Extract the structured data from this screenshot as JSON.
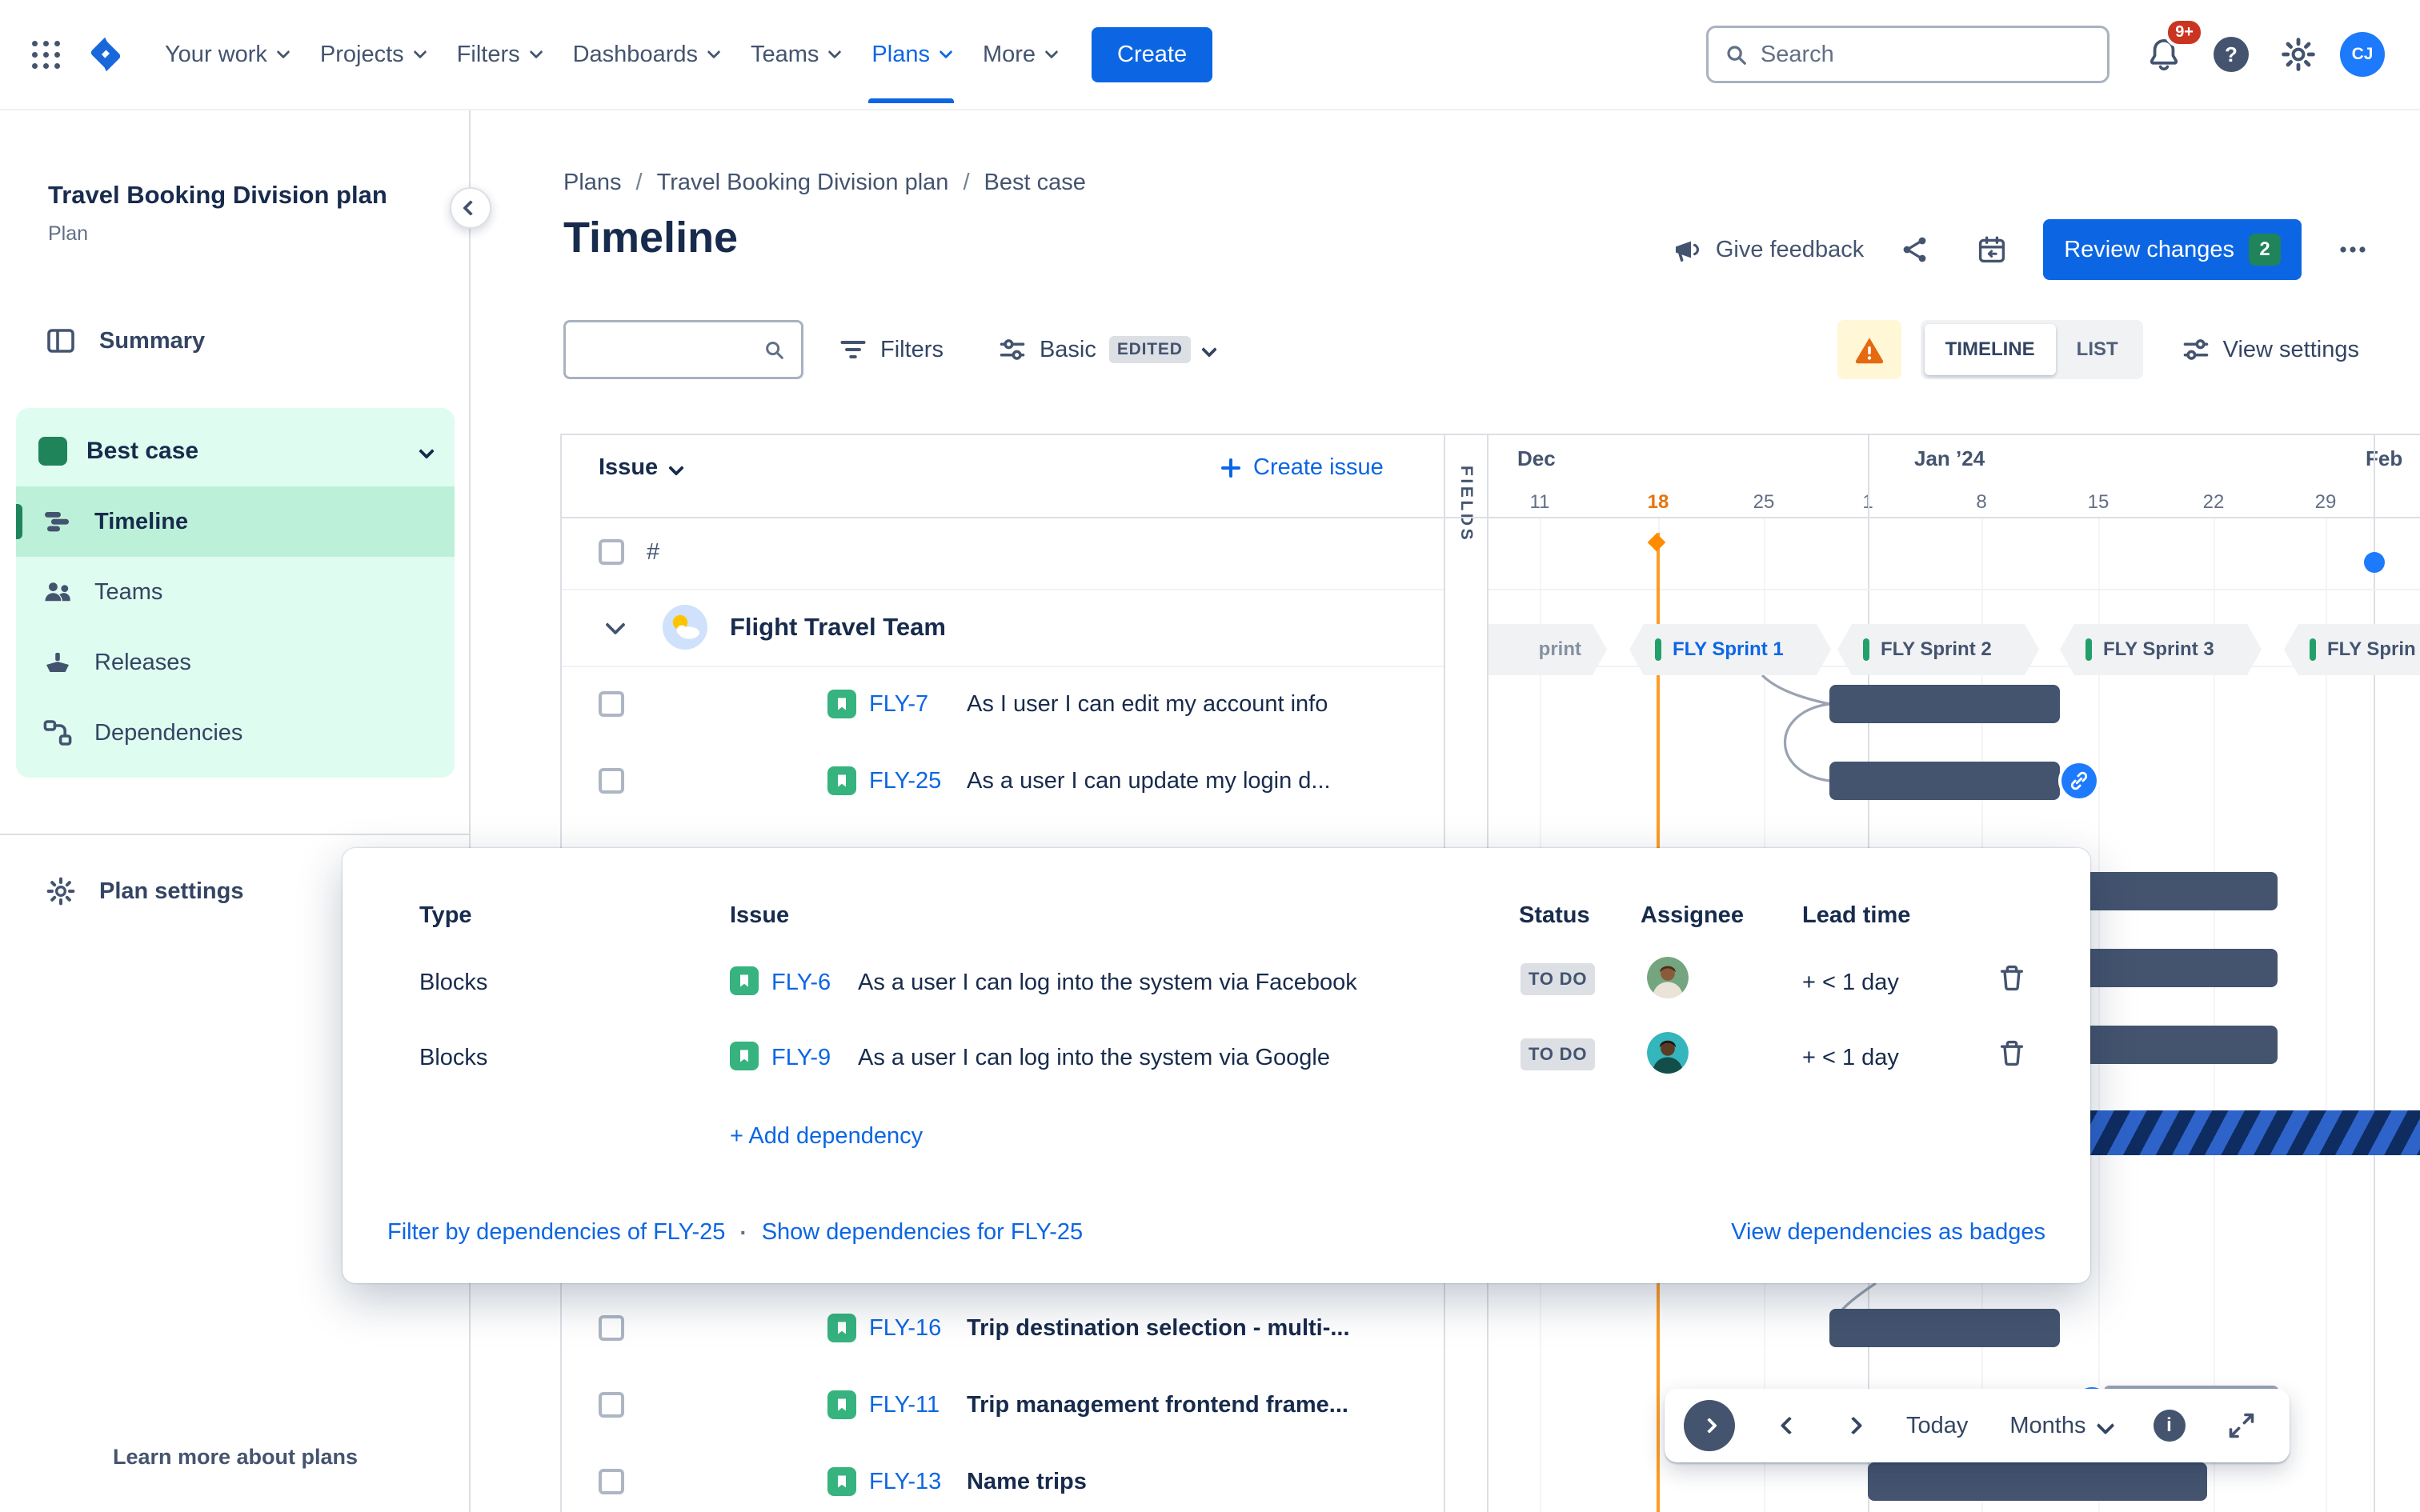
{
  "colors": {
    "accent_blue": "#0C66E4",
    "link_blue": "#1D7AFC",
    "bar_slate": "#44546F",
    "story_green": "#36B37E",
    "scenario_green_bg": "#DFFCF0",
    "selected_green_bg": "#BDF0D8",
    "today_orange": "#FF8B00",
    "warning_orange": "#E56910",
    "status_badge_bg": "#DCDFE4",
    "review_badge_green": "#1F845A",
    "alert_red": "#CA3521"
  },
  "nav": {
    "items": [
      {
        "label": "Your work"
      },
      {
        "label": "Projects"
      },
      {
        "label": "Filters"
      },
      {
        "label": "Dashboards"
      },
      {
        "label": "Teams"
      },
      {
        "label": "Plans"
      },
      {
        "label": "More"
      }
    ],
    "create_label": "Create",
    "search_placeholder": "Search",
    "notifications_badge": "9+",
    "avatar_initials": "CJ"
  },
  "sidebar": {
    "plan_title": "Travel Booking Division plan",
    "plan_subtitle": "Plan",
    "summary_label": "Summary",
    "scenario_label": "Best case",
    "items": [
      {
        "label": "Timeline"
      },
      {
        "label": "Teams"
      },
      {
        "label": "Releases"
      },
      {
        "label": "Dependencies"
      }
    ],
    "plan_settings_label": "Plan settings",
    "learn_more_label": "Learn more about plans"
  },
  "header": {
    "breadcrumb": [
      {
        "label": "Plans"
      },
      {
        "label": "Travel Booking Division plan"
      },
      {
        "label": "Best case"
      }
    ],
    "breadcrumb_sep": "/",
    "title": "Timeline",
    "feedback_label": "Give feedback",
    "review_label": "Review changes",
    "review_count": "2"
  },
  "toolbar": {
    "filters_label": "Filters",
    "view_label": "Basic",
    "view_badge": "EDITED",
    "timeline_label": "TIMELINE",
    "list_label": "LIST",
    "view_settings_label": "View settings"
  },
  "table": {
    "issue_header": "Issue",
    "create_issue_label": "Create issue",
    "fields_label": "FIELDS",
    "hash_label": "#",
    "group_name": "Flight Travel Team",
    "rows": [
      {
        "key": "FLY-7",
        "summary": "As I user I can edit my account info"
      },
      {
        "key": "FLY-25",
        "summary": "As a user I can update my login d..."
      },
      {
        "key": "FLY-16",
        "summary": "Trip destination selection - multi-..."
      },
      {
        "key": "FLY-11",
        "summary": "Trip management frontend frame..."
      },
      {
        "key": "FLY-13",
        "summary": "Name trips"
      }
    ]
  },
  "timeline": {
    "months": [
      {
        "label": "Dec"
      },
      {
        "label": "Jan ’24"
      },
      {
        "label": "Feb"
      }
    ],
    "ticks": [
      {
        "label": "11"
      },
      {
        "label": "18",
        "today": true
      },
      {
        "label": "25"
      },
      {
        "label": "1"
      },
      {
        "label": "8"
      },
      {
        "label": "15"
      },
      {
        "label": "22"
      },
      {
        "label": "29"
      }
    ],
    "sprints": [
      {
        "label": "print",
        "state": "past"
      },
      {
        "label": "FLY Sprint 1",
        "state": "active"
      },
      {
        "label": "FLY Sprint 2",
        "state": "future"
      },
      {
        "label": "FLY Sprint 3",
        "state": "future"
      },
      {
        "label": "FLY Sprin",
        "state": "future"
      }
    ]
  },
  "popup": {
    "columns": [
      {
        "label": "Type"
      },
      {
        "label": "Issue"
      },
      {
        "label": "Status"
      },
      {
        "label": "Assignee"
      },
      {
        "label": "Lead time"
      }
    ],
    "rows": [
      {
        "type": "Blocks",
        "key": "FLY-6",
        "summary": "As a user I can log into the system via Facebook",
        "status": "TO DO",
        "lead_time": "+ < 1 day"
      },
      {
        "type": "Blocks",
        "key": "FLY-9",
        "summary": "As a user I can log into the system via Google",
        "status": "TO DO",
        "lead_time": "+ < 1 day"
      }
    ],
    "add_label": "+ Add dependency",
    "filter_link": "Filter by dependencies of FLY-25",
    "links_sep": "·",
    "show_link": "Show dependencies for FLY-25",
    "badges_link": "View dependencies as badges"
  },
  "controls": {
    "today_label": "Today",
    "zoom_label": "Months"
  }
}
